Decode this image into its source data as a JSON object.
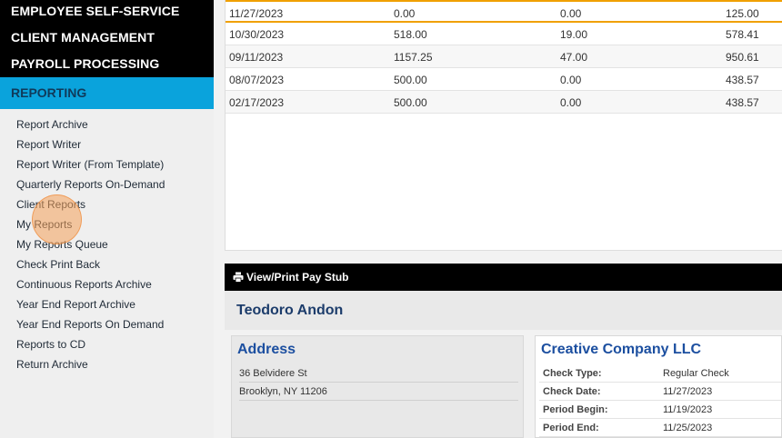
{
  "sidebar": {
    "top_items": [
      "EMPLOYEE SELF-SERVICE",
      "CLIENT MANAGEMENT",
      "PAYROLL PROCESSING"
    ],
    "active_section": "REPORTING",
    "sub_items": [
      "Report Archive",
      "Report Writer",
      "Report Writer (From Template)",
      "Quarterly Reports On-Demand",
      "Client Reports",
      "My Reports",
      "My Reports Queue",
      "Check Print Back",
      "Continuous Reports Archive",
      "Year End Report Archive",
      "Year End Reports On Demand",
      "Reports to CD",
      "Return Archive"
    ]
  },
  "history": {
    "rows": [
      {
        "date": "11/27/2023",
        "col2": "0.00",
        "col3": "0.00",
        "col4": "125.00"
      },
      {
        "date": "10/30/2023",
        "col2": "518.00",
        "col3": "19.00",
        "col4": "578.41"
      },
      {
        "date": "09/11/2023",
        "col2": "1157.25",
        "col3": "47.00",
        "col4": "950.61"
      },
      {
        "date": "08/07/2023",
        "col2": "500.00",
        "col3": "0.00",
        "col4": "438.57"
      },
      {
        "date": "02/17/2023",
        "col2": "500.00",
        "col3": "0.00",
        "col4": "438.57"
      }
    ]
  },
  "stub": {
    "view_print_label": "View/Print Pay Stub",
    "employee_name": "Teodoro Andon",
    "address_title": "Address",
    "address_line1": "36 Belvidere St",
    "address_line2": "Brooklyn, NY 11206",
    "company_name": "Creative Company LLC",
    "fields": [
      {
        "label": "Check Type:",
        "value": "Regular Check"
      },
      {
        "label": "Check Date:",
        "value": "11/27/2023"
      },
      {
        "label": "Period Begin:",
        "value": "11/19/2023"
      },
      {
        "label": "Period End:",
        "value": "11/25/2023"
      }
    ]
  },
  "colors": {
    "accent": "#0aa3dc",
    "selection": "#f0a000",
    "title_blue": "#1c4fa0"
  }
}
